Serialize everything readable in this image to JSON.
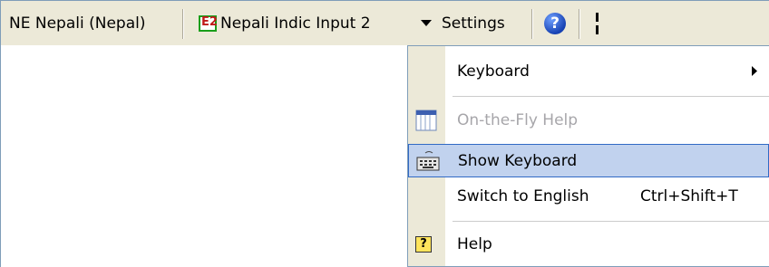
{
  "toolbar": {
    "language": "NE Nepali (Nepal)",
    "input_method": "Nepali Indic Input 2",
    "settings": "Settings",
    "help_glyph": "?"
  },
  "menu": {
    "items": [
      {
        "label": "Keyboard",
        "submenu": true
      },
      {
        "label": "On-the-Fly Help",
        "disabled": true,
        "icon": "grid-icon"
      },
      {
        "label": "Show Keyboard",
        "highlighted": true,
        "icon": "keyboard-icon"
      },
      {
        "label": "Switch to English",
        "shortcut": "Ctrl+Shift+T"
      },
      {
        "label": "Help",
        "icon": "help-icon",
        "icon_glyph": "?"
      }
    ]
  },
  "colors": {
    "bar": "#ece9d8",
    "highlight": "#c1d2ee",
    "highlight_border": "#316ac5",
    "disabled_text": "#a7a6aa"
  }
}
